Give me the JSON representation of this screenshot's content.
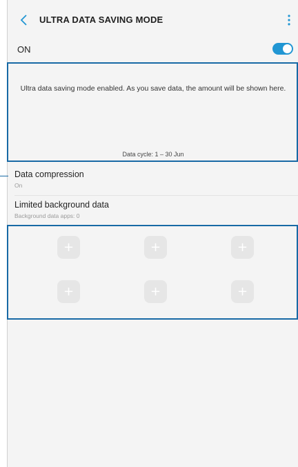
{
  "header": {
    "title": "ULTRA DATA SAVING MODE",
    "back_icon": "chevron-left-icon",
    "more_icon": "more-vertical-icon"
  },
  "master_switch": {
    "label": "ON",
    "state": true,
    "accent_color": "#2196d3"
  },
  "summary": {
    "message": "Ultra data saving mode enabled. As you save data, the amount will be shown here.",
    "data_cycle": "Data cycle: 1 – 30 Jun"
  },
  "settings": [
    {
      "title": "Data compression",
      "subtitle": "On"
    },
    {
      "title": "Limited background data",
      "subtitle": "Background data apps: 0"
    }
  ],
  "app_slots": {
    "icon": "plus-icon",
    "glyph": "+",
    "count": 6
  },
  "callout_color": "#1769a5"
}
